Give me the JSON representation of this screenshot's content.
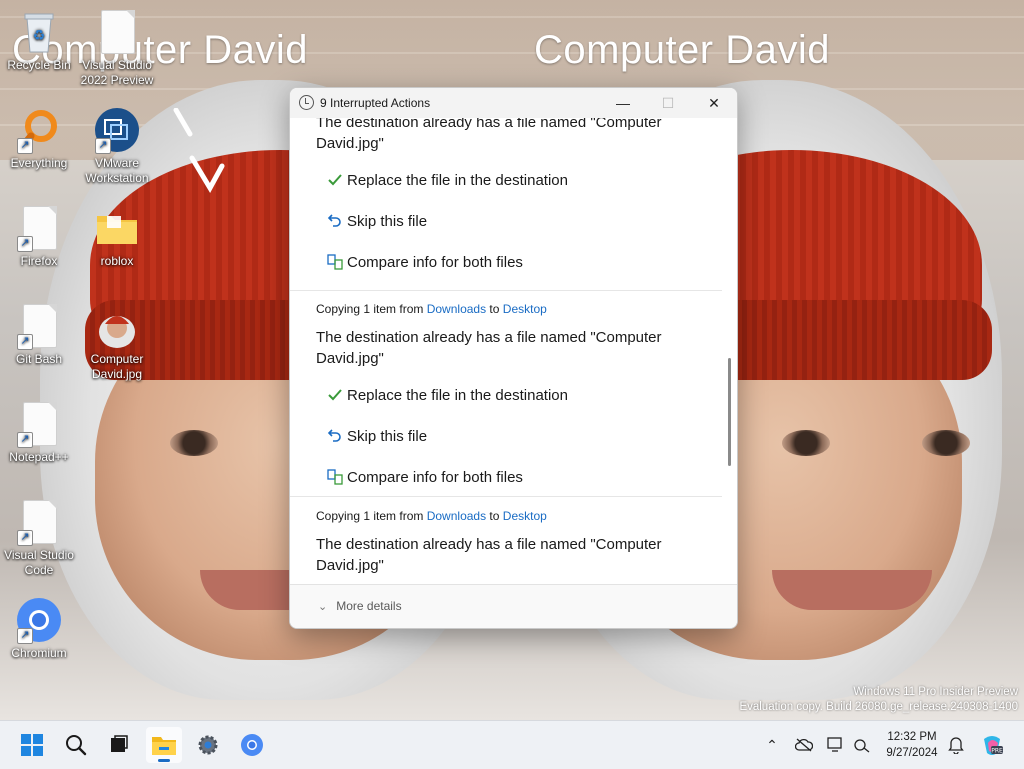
{
  "wallpaper": {
    "caption_left": "Computer David",
    "caption_right": "Computer David"
  },
  "watermark": {
    "line1": "Windows 11 Pro Insider Preview",
    "line2": "Evaluation copy. Build 26080.ge_release.240308-1400"
  },
  "desktop_icons": [
    {
      "label": "Recycle Bin",
      "icon": "recycle-bin-icon"
    },
    {
      "label": "Visual Studio 2022 Preview",
      "icon": "file-icon"
    },
    {
      "label": "Everything",
      "icon": "magnifier-icon"
    },
    {
      "label": "VMware Workstation",
      "icon": "vmware-icon"
    },
    {
      "label": "Firefox",
      "icon": "file-icon"
    },
    {
      "label": "roblox",
      "icon": "folder-icon"
    },
    {
      "label": "Git Bash",
      "icon": "file-icon"
    },
    {
      "label": "Computer David.jpg",
      "icon": "image-thumbnail-icon"
    },
    {
      "label": "Notepad++",
      "icon": "file-icon"
    },
    {
      "label": "Visual Studio Code",
      "icon": "file-icon"
    },
    {
      "label": "Chromium",
      "icon": "chromium-icon"
    }
  ],
  "dialog": {
    "title": "9 Interrupted Actions",
    "minimize_glyph": "—",
    "maximize_glyph": "☐",
    "close_glyph": "✕",
    "items": [
      {
        "message": "The destination already has a file named \"Computer David.jpg\"",
        "options": {
          "replace": "Replace the file in the destination",
          "skip": "Skip this file",
          "compare": "Compare info for both files"
        }
      },
      {
        "header": {
          "prefix": "Copying 1 item from ",
          "source": "Downloads",
          "mid": " to ",
          "dest": "Desktop"
        },
        "message": "The destination already has a file named \"Computer David.jpg\"",
        "options": {
          "replace": "Replace the file in the destination",
          "skip": "Skip this file",
          "compare": "Compare info for both files"
        }
      },
      {
        "header": {
          "prefix": "Copying 1 item from ",
          "source": "Downloads",
          "mid": " to ",
          "dest": "Desktop"
        },
        "message": "The destination already has a file named \"Computer David.jpg\""
      }
    ],
    "more_details": "More details"
  },
  "taskbar": {
    "apps": [
      "start-icon",
      "search-icon",
      "task-view-icon",
      "file-explorer-icon",
      "settings-icon",
      "chromium-icon"
    ],
    "tray": [
      "chevron-up-icon",
      "cloud-off-icon",
      "display-icon",
      "security-icon",
      "bell-icon",
      "copilot-icon"
    ],
    "time": "12:32 PM",
    "date": "9/27/2024"
  }
}
